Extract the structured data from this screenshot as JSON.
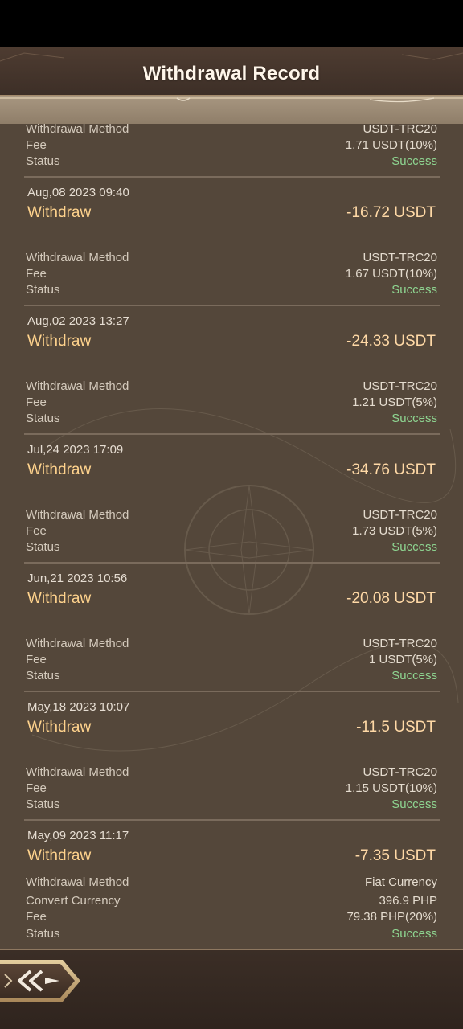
{
  "header": {
    "title": "Withdrawal Record"
  },
  "labels": {
    "method": "Withdrawal Method",
    "convert": "Convert Currency",
    "fee": "Fee",
    "status": "Status"
  },
  "partial_record": {
    "method": "USDT-TRC20",
    "fee": "1.71 USDT(10%)",
    "status": "Success"
  },
  "records": [
    {
      "date": "Aug,08 2023 09:40",
      "type": "Withdraw",
      "amount": "-16.72 USDT",
      "method": "USDT-TRC20",
      "fee": "1.67 USDT(10%)",
      "status": "Success"
    },
    {
      "date": "Aug,02 2023 13:27",
      "type": "Withdraw",
      "amount": "-24.33 USDT",
      "method": "USDT-TRC20",
      "fee": "1.21 USDT(5%)",
      "status": "Success"
    },
    {
      "date": "Jul,24 2023 17:09",
      "type": "Withdraw",
      "amount": "-34.76 USDT",
      "method": "USDT-TRC20",
      "fee": "1.73 USDT(5%)",
      "status": "Success"
    },
    {
      "date": "Jun,21 2023 10:56",
      "type": "Withdraw",
      "amount": "-20.08 USDT",
      "method": "USDT-TRC20",
      "fee": "1 USDT(5%)",
      "status": "Success"
    },
    {
      "date": "May,18 2023 10:07",
      "type": "Withdraw",
      "amount": "-11.5 USDT",
      "method": "USDT-TRC20",
      "fee": "1.15 USDT(10%)",
      "status": "Success"
    },
    {
      "date": "May,09 2023 11:17",
      "type": "Withdraw",
      "amount": "-7.35 USDT",
      "method": "Fiat Currency",
      "convert": "396.9 PHP",
      "fee": "79.38 PHP(20%)",
      "status": "Success"
    }
  ],
  "icons": {
    "back": "back-double-chevron-icon"
  },
  "colors": {
    "background": "#54473a",
    "success": "#8ed591",
    "amount": "#ffd9a6",
    "type": "#ffd38d"
  }
}
